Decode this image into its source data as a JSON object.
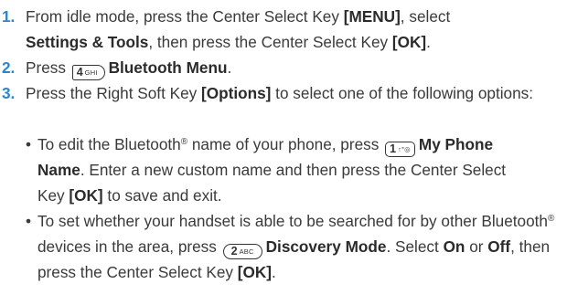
{
  "steps": [
    {
      "number": "1.",
      "t1": "From idle mode, press the Center Select Key ",
      "b1": "[MENU]",
      "t2": ", select",
      "b2": "Settings & Tools",
      "t3": ", then press the Center Select Key ",
      "b3": "[OK]",
      "t4": "."
    },
    {
      "number": "2.",
      "t1": "Press ",
      "key_main": "4",
      "key_sub": "GHI",
      "b1": "Bluetooth Menu",
      "t2": "."
    },
    {
      "number": "3.",
      "t1": "Press the Right Soft Key ",
      "b1": "[Options]",
      "t2": " to select one of the following options:"
    }
  ],
  "bullets": [
    {
      "dot": "•",
      "t1": "To edit the Bluetooth",
      "sup": "®",
      "t2": " name of your phone, press ",
      "key_main": "1",
      "key_sub": "↑ᐤ◎",
      "b1": "My Phone Name",
      "t3": ". Enter a new custom name and then press the Center Select Key ",
      "b2": "[OK]",
      "t4": " to save and exit."
    },
    {
      "dot": "•",
      "t1": "To set whether your handset is able to be searched for by other Bluetooth",
      "sup": "®",
      "t2": " devices in the area, press ",
      "key_main": "2",
      "key_sub": "ABC",
      "b1": "Discovery Mode",
      "t3": ". Select ",
      "b2": "On",
      "t4": " or ",
      "b3": "Off",
      "t5": ", then press the Center Select Key ",
      "b4": "[OK]",
      "t6": "."
    }
  ]
}
